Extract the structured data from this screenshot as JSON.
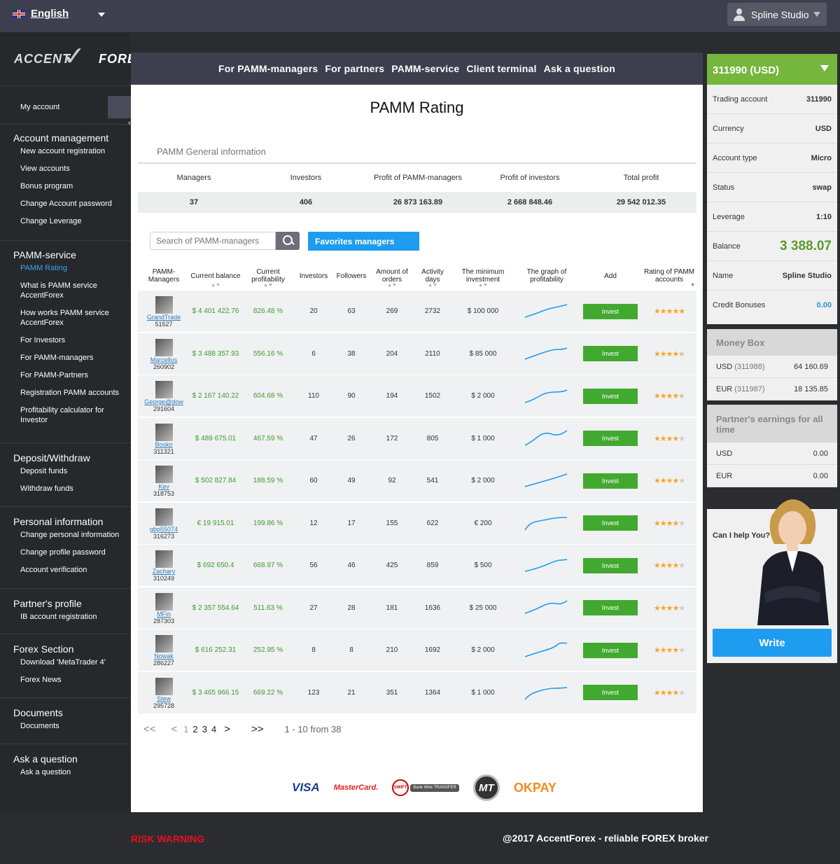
{
  "topbar": {
    "language": "English",
    "user": "Spline Studio"
  },
  "logo": {
    "left": "ACCENT",
    "right": "FOREX"
  },
  "sidebar": {
    "my_account": "My account",
    "groups": [
      {
        "title": "Account management",
        "items": [
          "New account registration",
          "View accounts",
          "Bonus program",
          "Change Account password",
          "Change Leverage"
        ]
      },
      {
        "title": "PAMM-service",
        "items": [
          "PAMM Rating",
          "What is PAMM service AccentForex",
          "How works PAMM service AccentForex",
          "For Investors",
          "For PAMM-managers",
          "For PAMM-Partners",
          "Registration PAMM accounts",
          "Profitability calculator for Investor"
        ]
      },
      {
        "title": "Deposit/Withdraw",
        "items": [
          "Deposit funds",
          "Withdraw funds"
        ]
      },
      {
        "title": "Personal information",
        "items": [
          "Change personal information",
          "Change profile password",
          "Account verification"
        ]
      },
      {
        "title": "Partner's profile",
        "items": [
          "IB account registration"
        ]
      },
      {
        "title": "Forex Section",
        "items": [
          "Download 'MetaTrader 4'",
          "Forex News"
        ]
      },
      {
        "title": "Documents",
        "items": [
          "Documents"
        ]
      },
      {
        "title": "Ask a question",
        "items": [
          "Ask a question"
        ]
      }
    ]
  },
  "mainnav": [
    "For PAMM-managers",
    "For partners",
    "PAMM-service",
    "Client terminal",
    "Ask a question"
  ],
  "page": {
    "title": "PAMM Rating"
  },
  "general": {
    "title": "PAMM General information",
    "headers": [
      "Managers",
      "Investors",
      "Profit of PAMM-managers",
      "Profit of investors",
      "Total profit"
    ],
    "values": [
      "37",
      "406",
      "26 873 163.89",
      "2 668 848.46",
      "29 542 012.35"
    ]
  },
  "search": {
    "placeholder": "Search of PAMM-managers"
  },
  "favorites": "Favorites managers",
  "table": {
    "headers": [
      "PAMM-Managers",
      "Current balance",
      "Current profitability",
      "Investors",
      "Followers",
      "Amount of orders",
      "Activity days",
      "The minimum investment",
      "The graph of profitability",
      "Add",
      "Rating of PAMM accounts"
    ],
    "invest_label": "Invest",
    "rows": [
      {
        "name": "GrandTrade",
        "id": "51527",
        "balance": "$ 4 401 422.76",
        "profit": "826.48 %",
        "investors": "20",
        "followers": "63",
        "orders": "269",
        "days": "2732",
        "min": "$ 100 000",
        "rating": 5
      },
      {
        "name": "Marcellus",
        "id": "260902",
        "balance": "$ 3 488 357.93",
        "profit": "556.16 %",
        "investors": "6",
        "followers": "38",
        "orders": "204",
        "days": "2110",
        "min": "$ 85 000",
        "rating": 4.5
      },
      {
        "name": "George@dow",
        "id": "291604",
        "balance": "$ 2 167 140.22",
        "profit": "604.68 %",
        "investors": "110",
        "followers": "90",
        "orders": "194",
        "days": "1502",
        "min": "$ 2 000",
        "rating": 4.5
      },
      {
        "name": "Bosko",
        "id": "311321",
        "balance": "$ 489 675.01",
        "profit": "467.59 %",
        "investors": "47",
        "followers": "26",
        "orders": "172",
        "days": "805",
        "min": "$ 1 000",
        "rating": 4
      },
      {
        "name": "Kev",
        "id": "318753",
        "balance": "$ 502 827.84",
        "profit": "188.59 %",
        "investors": "60",
        "followers": "49",
        "orders": "92",
        "days": "541",
        "min": "$ 2 000",
        "rating": 4
      },
      {
        "name": "gbp55074",
        "id": "316273",
        "balance": "€ 19 915.01",
        "profit": "199.86 %",
        "investors": "12",
        "followers": "17",
        "orders": "155",
        "days": "622",
        "min": "€ 200",
        "rating": 4
      },
      {
        "name": "Zachary",
        "id": "310249",
        "balance": "$ 692 650.4",
        "profit": "668.97 %",
        "investors": "56",
        "followers": "46",
        "orders": "425",
        "days": "859",
        "min": "$ 500",
        "rating": 4
      },
      {
        "name": "MFin",
        "id": "287303",
        "balance": "$ 2 357 554.64",
        "profit": "511.63 %",
        "investors": "27",
        "followers": "28",
        "orders": "181",
        "days": "1636",
        "min": "$ 25 000",
        "rating": 4
      },
      {
        "name": "Nowak",
        "id": "286227",
        "balance": "$ 616 252.31",
        "profit": "252.95 %",
        "investors": "8",
        "followers": "8",
        "orders": "210",
        "days": "1692",
        "min": "$ 2 000",
        "rating": 4
      },
      {
        "name": "Stew",
        "id": "295728",
        "balance": "$ 3 465 966.15",
        "profit": "669.22 %",
        "investors": "123",
        "followers": "21",
        "orders": "351",
        "days": "1364",
        "min": "$ 1 000",
        "rating": 4
      }
    ]
  },
  "pager": {
    "first": "<<",
    "prev": "<",
    "pages": [
      "1",
      "2",
      "3",
      "4"
    ],
    "next": ">",
    "last": ">>",
    "info": "1 - 10 from 38"
  },
  "payments": {
    "visa": "VISA",
    "mastercard": "MasterCard.",
    "swift": "SWIFT",
    "bankwire": "Bank Wire TRANSFER",
    "mt": "MT",
    "okpay": "OKPAY"
  },
  "account": {
    "header": "311990 (USD)",
    "rows": [
      {
        "label": "Trading account",
        "value": "311990"
      },
      {
        "label": "Currency",
        "value": "USD"
      },
      {
        "label": "Account type",
        "value": "Micro"
      },
      {
        "label": "Status",
        "value": "swap"
      },
      {
        "label": "Leverage",
        "value": "1:10"
      },
      {
        "label": "Balance",
        "value": "3 388.07"
      },
      {
        "label": "Name",
        "value": "Spline Studio"
      },
      {
        "label": "Credit Bonuses",
        "value": "0.00"
      }
    ]
  },
  "moneybox": {
    "title": "Money Box",
    "rows": [
      {
        "cur": "USD",
        "acc": "(311988)",
        "value": "64 160.69"
      },
      {
        "cur": "EUR",
        "acc": "(311987)",
        "value": "18 135.85"
      }
    ]
  },
  "partner": {
    "title": "Partner's earnings for all time",
    "rows": [
      {
        "cur": "USD",
        "value": "0.00"
      },
      {
        "cur": "EUR",
        "value": "0.00"
      }
    ]
  },
  "help": {
    "text": "Can I help You?",
    "button": "Write"
  },
  "footer": {
    "risk": "RISK WARNING",
    "copyright": "@2017 AccentForex - reliable FOREX broker"
  },
  "colors": {
    "accent_green": "#75b63c",
    "accent_blue": "#1e9cef",
    "risk_red": "#e8101c",
    "nav_dark": "#3d3f4f"
  }
}
